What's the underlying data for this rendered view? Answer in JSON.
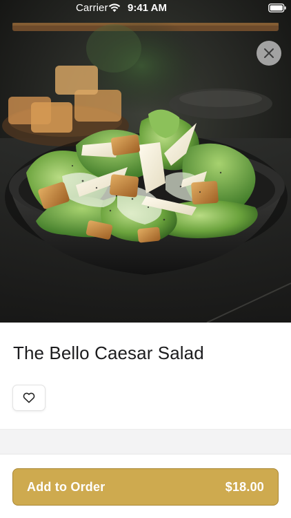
{
  "status_bar": {
    "carrier": "Carrier",
    "time": "9:41 AM",
    "wifi_icon": "wifi-icon",
    "battery_icon": "battery-full-icon"
  },
  "hero": {
    "image_subject": "caesar salad in a dark bowl with croutons and shaved parmesan",
    "close_icon": "close-icon"
  },
  "product": {
    "title": "The Bello Caesar Salad",
    "favorite_icon": "heart-outline-icon"
  },
  "order_button": {
    "label": "Add to Order",
    "price": "$18.00"
  },
  "colors": {
    "accent": "#ceaa4f",
    "accent_border": "#a98734",
    "title_text": "#1c1c1e",
    "button_text": "#ffffff",
    "section_gap": "#f3f3f4"
  }
}
